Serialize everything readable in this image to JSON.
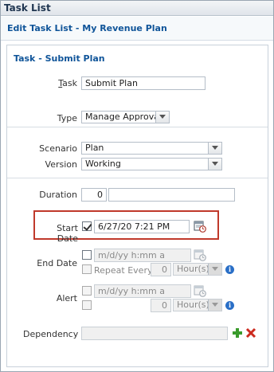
{
  "window": {
    "title": "Task List"
  },
  "dialog": {
    "title": "Edit Task List - My Revenue Plan"
  },
  "section": {
    "title": "Task - Submit Plan"
  },
  "form": {
    "task": {
      "label_accel": "T",
      "label_rest": "ask",
      "value": "Submit Plan"
    },
    "type": {
      "label": "Type",
      "value": "Manage Approvals"
    },
    "scenario": {
      "label": "Scenario",
      "value": "Plan"
    },
    "version": {
      "label": "Version",
      "value": "Working"
    },
    "duration": {
      "label": "Duration",
      "value": "0",
      "unit_value": ""
    },
    "start_date": {
      "label": "Start Date",
      "checked": true,
      "value": "6/27/20 7:21 PM"
    },
    "end_date": {
      "label": "End Date",
      "checked": false,
      "placeholder": "m/d/yy h:mm a",
      "repeat_label": "Repeat Every",
      "repeat_value": "0",
      "repeat_unit": "Hour(s)"
    },
    "alert": {
      "label": "Alert",
      "checked": false,
      "placeholder": "m/d/yy h:mm a",
      "repeat_value": "0",
      "repeat_unit": "Hour(s)"
    },
    "dependency": {
      "label": "Dependency",
      "value": ""
    }
  },
  "icons": {
    "calendar": "calendar-icon",
    "info": "info-icon",
    "add": "add-icon",
    "delete": "delete-icon"
  },
  "colors": {
    "title_text": "#1f3550",
    "section_text": "#0f5499",
    "highlight": "#c0392b",
    "add": "#3a9b2c",
    "delete": "#cc2a1e"
  }
}
